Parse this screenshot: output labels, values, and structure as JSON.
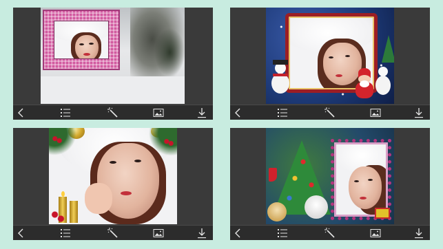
{
  "panels": [
    {
      "id": "snow-frame",
      "frame_style": "pink gingham frame on snowy forest",
      "colors": {
        "frame": "#d86aa8",
        "background": "#d9dadc"
      }
    },
    {
      "id": "santa-frame",
      "frame_style": "red ornate frame with snowmen and santa",
      "colors": {
        "frame": "#9c1e24",
        "background": "#1d3a78"
      }
    },
    {
      "id": "ornament-frame",
      "frame_style": "gold ornaments and candles",
      "colors": {
        "frame": "#c9a132",
        "background": "#eaeaea"
      }
    },
    {
      "id": "tree-frame",
      "frame_style": "christmas tree with bears and beaded frame",
      "colors": {
        "frame": "#b3347e",
        "background": "#2e6a3a"
      }
    }
  ],
  "toolbar": {
    "icons": [
      "back-icon",
      "list-icon",
      "magic-wand-icon",
      "image-icon",
      "download-icon"
    ]
  },
  "colors": {
    "page_background": "#c8ece0",
    "panel_background": "#3a3a3a",
    "toolbar_background": "#2c2c2c",
    "icon": "#e6e6e6"
  }
}
